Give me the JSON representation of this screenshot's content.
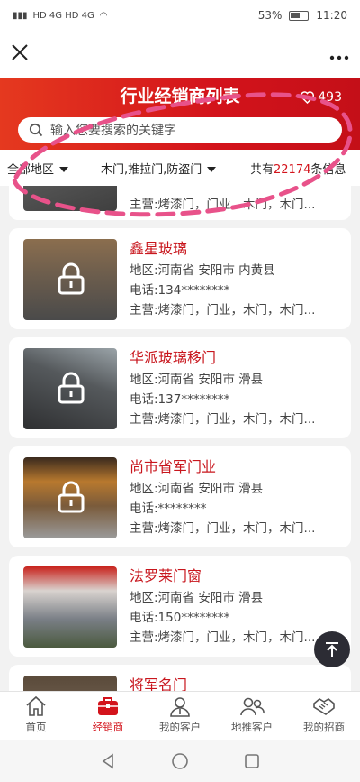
{
  "status": {
    "left": "HD 4G HD 4G",
    "battery": "53%",
    "time": "11:20"
  },
  "header": {
    "title": "行业经销商列表",
    "likes": "493"
  },
  "search": {
    "placeholder": "输入您要搜索的关键字"
  },
  "filter": {
    "region": "全部地区",
    "category": "木门,推拉门,防盗门",
    "total_prefix": "共有",
    "total_count": "22174",
    "total_suffix": "条信息"
  },
  "dealers": [
    {
      "name": "",
      "region": "",
      "phone": "",
      "main": "主营:烤漆门，门业，木门，木门..."
    },
    {
      "name": "鑫星玻璃",
      "region": "地区:河南省 安阳市 内黄县",
      "phone": "电话:134********",
      "main": "主营:烤漆门，门业，木门，木门..."
    },
    {
      "name": "华派玻璃移门",
      "region": "地区:河南省 安阳市 滑县",
      "phone": "电话:137********",
      "main": "主营:烤漆门，门业，木门，木门..."
    },
    {
      "name": "尚市省军门业",
      "region": "地区:河南省 安阳市 滑县",
      "phone": "电话:********",
      "main": "主营:烤漆门，门业，木门，木门..."
    },
    {
      "name": "法罗莱门窗",
      "region": "地区:河南省 安阳市 滑县",
      "phone": "电话:150********",
      "main": "主营:烤漆门，门业，木门，木门..."
    },
    {
      "name": "将军名门",
      "region": "",
      "phone": "",
      "main": ""
    }
  ],
  "tabs": [
    {
      "label": "首页",
      "icon": "home-icon"
    },
    {
      "label": "经销商",
      "icon": "briefcase-icon"
    },
    {
      "label": "我的客户",
      "icon": "user-icon"
    },
    {
      "label": "地推客户",
      "icon": "users-icon"
    },
    {
      "label": "我的招商",
      "icon": "handshake-icon"
    }
  ],
  "colors": {
    "accent": "#d3131b",
    "annotation": "#e8528a"
  }
}
